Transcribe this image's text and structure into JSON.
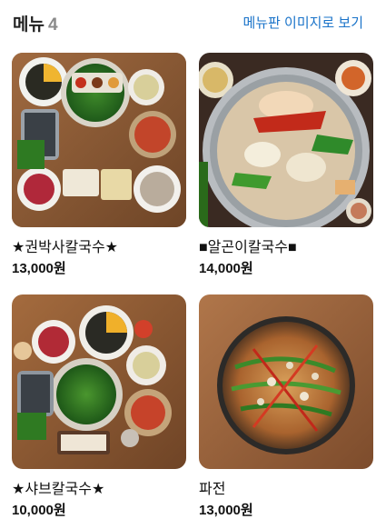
{
  "header": {
    "title": "메뉴",
    "count": "4",
    "view_image_link": "메뉴판 이미지로 보기"
  },
  "menu_items": [
    {
      "name": "★권박사칼국수★",
      "price": "13,000원",
      "image": "kalguksu-set-photo"
    },
    {
      "name": "■알곤이칼국수■",
      "price": "14,000원",
      "image": "seafood-hotpot-photo"
    },
    {
      "name": "★샤브칼국수★",
      "price": "10,000원",
      "image": "shabu-kalguksu-set-photo"
    },
    {
      "name": "파전",
      "price": "13,000원",
      "image": "pajeon-photo"
    }
  ]
}
